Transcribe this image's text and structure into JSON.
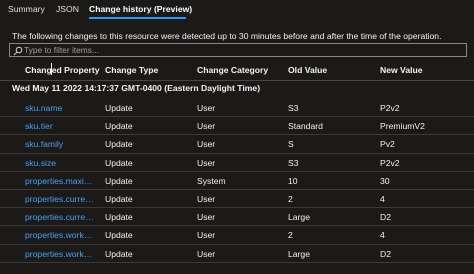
{
  "tabs": [
    {
      "label": "Summary"
    },
    {
      "label": "JSON"
    },
    {
      "label": "Change history (Preview)"
    }
  ],
  "info_text": "The following changes to this resource were detected up to 30 minutes before and after the time of the operation.",
  "filter": {
    "placeholder": "Type to filter items..."
  },
  "columns": [
    "Changed Property",
    "Change Type",
    "Change Category",
    "Old Value",
    "New Value"
  ],
  "group_header": "Wed May 11 2022 14:17:37 GMT-0400 (Eastern Daylight Time)",
  "rows": [
    {
      "property": "sku.name",
      "type": "Update",
      "category": "User",
      "old": "S3",
      "new": "P2v2"
    },
    {
      "property": "sku.tier",
      "type": "Update",
      "category": "User",
      "old": "Standard",
      "new": "PremiumV2"
    },
    {
      "property": "sku.family",
      "type": "Update",
      "category": "User",
      "old": "S",
      "new": "Pv2"
    },
    {
      "property": "sku.size",
      "type": "Update",
      "category": "User",
      "old": "S3",
      "new": "P2v2"
    },
    {
      "property": "properties.maximum...",
      "type": "Update",
      "category": "System",
      "old": "10",
      "new": "30"
    },
    {
      "property": "properties.currentW...",
      "type": "Update",
      "category": "User",
      "old": "2",
      "new": "4"
    },
    {
      "property": "properties.currentW...",
      "type": "Update",
      "category": "User",
      "old": "Large",
      "new": "D2"
    },
    {
      "property": "properties.workerSiz...",
      "type": "Update",
      "category": "User",
      "old": "2",
      "new": "4"
    },
    {
      "property": "properties.workerSize",
      "type": "Update",
      "category": "User",
      "old": "Large",
      "new": "D2"
    }
  ],
  "colors": {
    "background": "#1b1a19",
    "link": "#4aa0f0",
    "accent": "#2899f5"
  }
}
